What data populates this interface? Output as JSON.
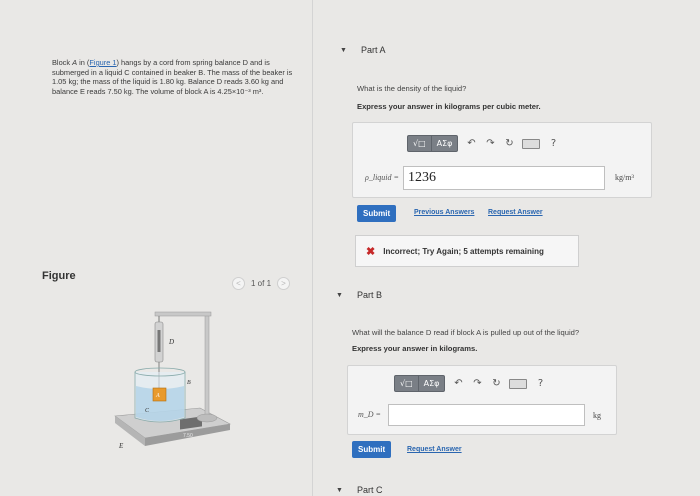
{
  "problem": {
    "text_before_link": "Block ",
    "block_label": "A",
    "text_in": " in (",
    "figure_link": "Figure 1",
    "text_rest": ") hangs by a cord from spring balance D and is submerged in a liquid C contained in beaker B. The mass of the beaker is 1.05 kg; the mass of the liquid is 1.80 kg. Balance D reads 3.60 kg and balance E reads 7.50 kg. The volume of block A is 4.25×10⁻³ m³."
  },
  "figure": {
    "label": "Figure",
    "pager": "1 of 1",
    "prev": "<",
    "next": ">",
    "labels": {
      "D": "D",
      "B": "B",
      "C": "C",
      "A": "A",
      "E": "E",
      "readout": "7.50"
    }
  },
  "partA": {
    "caret": "▼",
    "title": "Part A",
    "question": "What is the density of the liquid?",
    "instruction": "Express your answer in kilograms per cubic meter.",
    "toolbar": {
      "sqrt": "√□",
      "greek": "ΑΣφ",
      "undo": "↶",
      "redo": "↷",
      "reset": "↻",
      "help": "?"
    },
    "variable": "ρ_liquid =",
    "value": "1236",
    "unit": "kg/m³",
    "submit": "Submit",
    "previous_answers": "Previous Answers",
    "request_answer": "Request Answer",
    "feedback_icon": "✖",
    "feedback": "Incorrect; Try Again; 5 attempts remaining"
  },
  "partB": {
    "caret": "▼",
    "title": "Part B",
    "question": "What will the balance D read if block A is pulled up out of the liquid?",
    "instruction": "Express your answer in kilograms.",
    "toolbar": {
      "sqrt": "√□",
      "greek": "ΑΣφ",
      "undo": "↶",
      "redo": "↷",
      "reset": "↻",
      "help": "?"
    },
    "variable": "m_D =",
    "value": "",
    "unit": "kg",
    "submit": "Submit",
    "request_answer": "Request Answer"
  },
  "partC": {
    "caret": "▼",
    "title": "Part C"
  },
  "colors": {
    "submit": "#2f6fbf",
    "link": "#2a66b0",
    "error": "#c62828",
    "toolbar": "#7a7f86"
  }
}
